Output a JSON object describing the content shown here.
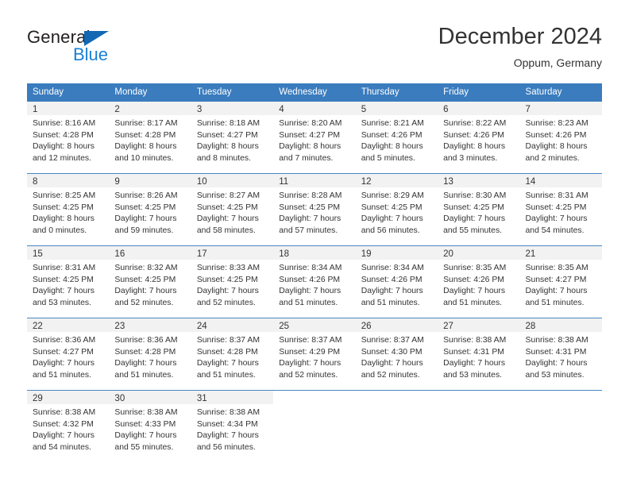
{
  "brand": {
    "name_top": "General",
    "name_bottom": "Blue",
    "triangle_color": "#1268b3",
    "blue_color": "#1c7fd4"
  },
  "header": {
    "title": "December 2024",
    "location": "Oppum, Germany"
  },
  "theme": {
    "header_bg": "#3a7cbe",
    "header_text": "#ffffff",
    "daynum_bg": "#f2f2f2",
    "row_divider": "#4a86c4",
    "body_text": "#333333"
  },
  "weekdays": [
    "Sunday",
    "Monday",
    "Tuesday",
    "Wednesday",
    "Thursday",
    "Friday",
    "Saturday"
  ],
  "weeks": [
    [
      {
        "day": "1",
        "sunrise": "Sunrise: 8:16 AM",
        "sunset": "Sunset: 4:28 PM",
        "daylight1": "Daylight: 8 hours",
        "daylight2": "and 12 minutes."
      },
      {
        "day": "2",
        "sunrise": "Sunrise: 8:17 AM",
        "sunset": "Sunset: 4:28 PM",
        "daylight1": "Daylight: 8 hours",
        "daylight2": "and 10 minutes."
      },
      {
        "day": "3",
        "sunrise": "Sunrise: 8:18 AM",
        "sunset": "Sunset: 4:27 PM",
        "daylight1": "Daylight: 8 hours",
        "daylight2": "and 8 minutes."
      },
      {
        "day": "4",
        "sunrise": "Sunrise: 8:20 AM",
        "sunset": "Sunset: 4:27 PM",
        "daylight1": "Daylight: 8 hours",
        "daylight2": "and 7 minutes."
      },
      {
        "day": "5",
        "sunrise": "Sunrise: 8:21 AM",
        "sunset": "Sunset: 4:26 PM",
        "daylight1": "Daylight: 8 hours",
        "daylight2": "and 5 minutes."
      },
      {
        "day": "6",
        "sunrise": "Sunrise: 8:22 AM",
        "sunset": "Sunset: 4:26 PM",
        "daylight1": "Daylight: 8 hours",
        "daylight2": "and 3 minutes."
      },
      {
        "day": "7",
        "sunrise": "Sunrise: 8:23 AM",
        "sunset": "Sunset: 4:26 PM",
        "daylight1": "Daylight: 8 hours",
        "daylight2": "and 2 minutes."
      }
    ],
    [
      {
        "day": "8",
        "sunrise": "Sunrise: 8:25 AM",
        "sunset": "Sunset: 4:25 PM",
        "daylight1": "Daylight: 8 hours",
        "daylight2": "and 0 minutes."
      },
      {
        "day": "9",
        "sunrise": "Sunrise: 8:26 AM",
        "sunset": "Sunset: 4:25 PM",
        "daylight1": "Daylight: 7 hours",
        "daylight2": "and 59 minutes."
      },
      {
        "day": "10",
        "sunrise": "Sunrise: 8:27 AM",
        "sunset": "Sunset: 4:25 PM",
        "daylight1": "Daylight: 7 hours",
        "daylight2": "and 58 minutes."
      },
      {
        "day": "11",
        "sunrise": "Sunrise: 8:28 AM",
        "sunset": "Sunset: 4:25 PM",
        "daylight1": "Daylight: 7 hours",
        "daylight2": "and 57 minutes."
      },
      {
        "day": "12",
        "sunrise": "Sunrise: 8:29 AM",
        "sunset": "Sunset: 4:25 PM",
        "daylight1": "Daylight: 7 hours",
        "daylight2": "and 56 minutes."
      },
      {
        "day": "13",
        "sunrise": "Sunrise: 8:30 AM",
        "sunset": "Sunset: 4:25 PM",
        "daylight1": "Daylight: 7 hours",
        "daylight2": "and 55 minutes."
      },
      {
        "day": "14",
        "sunrise": "Sunrise: 8:31 AM",
        "sunset": "Sunset: 4:25 PM",
        "daylight1": "Daylight: 7 hours",
        "daylight2": "and 54 minutes."
      }
    ],
    [
      {
        "day": "15",
        "sunrise": "Sunrise: 8:31 AM",
        "sunset": "Sunset: 4:25 PM",
        "daylight1": "Daylight: 7 hours",
        "daylight2": "and 53 minutes."
      },
      {
        "day": "16",
        "sunrise": "Sunrise: 8:32 AM",
        "sunset": "Sunset: 4:25 PM",
        "daylight1": "Daylight: 7 hours",
        "daylight2": "and 52 minutes."
      },
      {
        "day": "17",
        "sunrise": "Sunrise: 8:33 AM",
        "sunset": "Sunset: 4:25 PM",
        "daylight1": "Daylight: 7 hours",
        "daylight2": "and 52 minutes."
      },
      {
        "day": "18",
        "sunrise": "Sunrise: 8:34 AM",
        "sunset": "Sunset: 4:26 PM",
        "daylight1": "Daylight: 7 hours",
        "daylight2": "and 51 minutes."
      },
      {
        "day": "19",
        "sunrise": "Sunrise: 8:34 AM",
        "sunset": "Sunset: 4:26 PM",
        "daylight1": "Daylight: 7 hours",
        "daylight2": "and 51 minutes."
      },
      {
        "day": "20",
        "sunrise": "Sunrise: 8:35 AM",
        "sunset": "Sunset: 4:26 PM",
        "daylight1": "Daylight: 7 hours",
        "daylight2": "and 51 minutes."
      },
      {
        "day": "21",
        "sunrise": "Sunrise: 8:35 AM",
        "sunset": "Sunset: 4:27 PM",
        "daylight1": "Daylight: 7 hours",
        "daylight2": "and 51 minutes."
      }
    ],
    [
      {
        "day": "22",
        "sunrise": "Sunrise: 8:36 AM",
        "sunset": "Sunset: 4:27 PM",
        "daylight1": "Daylight: 7 hours",
        "daylight2": "and 51 minutes."
      },
      {
        "day": "23",
        "sunrise": "Sunrise: 8:36 AM",
        "sunset": "Sunset: 4:28 PM",
        "daylight1": "Daylight: 7 hours",
        "daylight2": "and 51 minutes."
      },
      {
        "day": "24",
        "sunrise": "Sunrise: 8:37 AM",
        "sunset": "Sunset: 4:28 PM",
        "daylight1": "Daylight: 7 hours",
        "daylight2": "and 51 minutes."
      },
      {
        "day": "25",
        "sunrise": "Sunrise: 8:37 AM",
        "sunset": "Sunset: 4:29 PM",
        "daylight1": "Daylight: 7 hours",
        "daylight2": "and 52 minutes."
      },
      {
        "day": "26",
        "sunrise": "Sunrise: 8:37 AM",
        "sunset": "Sunset: 4:30 PM",
        "daylight1": "Daylight: 7 hours",
        "daylight2": "and 52 minutes."
      },
      {
        "day": "27",
        "sunrise": "Sunrise: 8:38 AM",
        "sunset": "Sunset: 4:31 PM",
        "daylight1": "Daylight: 7 hours",
        "daylight2": "and 53 minutes."
      },
      {
        "day": "28",
        "sunrise": "Sunrise: 8:38 AM",
        "sunset": "Sunset: 4:31 PM",
        "daylight1": "Daylight: 7 hours",
        "daylight2": "and 53 minutes."
      }
    ],
    [
      {
        "day": "29",
        "sunrise": "Sunrise: 8:38 AM",
        "sunset": "Sunset: 4:32 PM",
        "daylight1": "Daylight: 7 hours",
        "daylight2": "and 54 minutes."
      },
      {
        "day": "30",
        "sunrise": "Sunrise: 8:38 AM",
        "sunset": "Sunset: 4:33 PM",
        "daylight1": "Daylight: 7 hours",
        "daylight2": "and 55 minutes."
      },
      {
        "day": "31",
        "sunrise": "Sunrise: 8:38 AM",
        "sunset": "Sunset: 4:34 PM",
        "daylight1": "Daylight: 7 hours",
        "daylight2": "and 56 minutes."
      },
      {
        "day": "",
        "sunrise": "",
        "sunset": "",
        "daylight1": "",
        "daylight2": ""
      },
      {
        "day": "",
        "sunrise": "",
        "sunset": "",
        "daylight1": "",
        "daylight2": ""
      },
      {
        "day": "",
        "sunrise": "",
        "sunset": "",
        "daylight1": "",
        "daylight2": ""
      },
      {
        "day": "",
        "sunrise": "",
        "sunset": "",
        "daylight1": "",
        "daylight2": ""
      }
    ]
  ]
}
